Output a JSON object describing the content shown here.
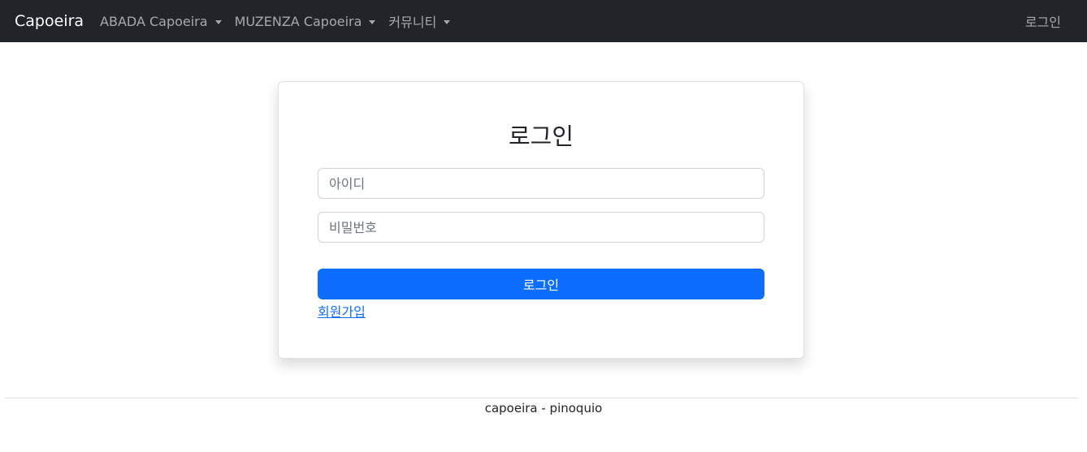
{
  "navbar": {
    "brand": "Capoeira",
    "items": [
      {
        "label": "ABADA Capoeira"
      },
      {
        "label": "MUZENZA Capoeira"
      },
      {
        "label": "커뮤니티"
      }
    ],
    "login": "로그인",
    "background": "#212529"
  },
  "login_form": {
    "title": "로그인",
    "id_placeholder": "아이디",
    "password_placeholder": "비밀번호",
    "submit_label": "로그인",
    "signup_link": "회원가입",
    "accent_color": "#0d6efd"
  },
  "footer": {
    "text": "capoeira - pinoquio"
  }
}
